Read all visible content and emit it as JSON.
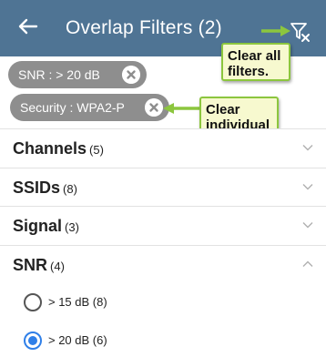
{
  "app_bar": {
    "title": "Overlap Filters (2)",
    "back_icon": "arrow-left-icon",
    "clear_all_icon": "filter-clear-icon",
    "background": "#4f7494"
  },
  "chips": [
    {
      "label": "SNR : > 20 dB",
      "remove_icon": "close-circle-icon"
    },
    {
      "label": "Security : WPA2-P",
      "remove_icon": "close-circle-icon"
    }
  ],
  "callouts": {
    "clear_all": "Clear all filters.",
    "clear_individual": "Clear individual filters.",
    "border_color": "#8cc63e",
    "fill_color": "#f7f9cf"
  },
  "sections": [
    {
      "name": "Channels",
      "count": "(5)",
      "expanded": false
    },
    {
      "name": "SSIDs",
      "count": "(8)",
      "expanded": false
    },
    {
      "name": "Signal",
      "count": "(3)",
      "expanded": false
    },
    {
      "name": "SNR",
      "count": "(4)",
      "expanded": true
    }
  ],
  "snr_options": [
    {
      "label": "> 15 dB (8)",
      "selected": false
    },
    {
      "label": "> 20 dB (6)",
      "selected": true
    }
  ],
  "accent_color": "#2f7fe8"
}
